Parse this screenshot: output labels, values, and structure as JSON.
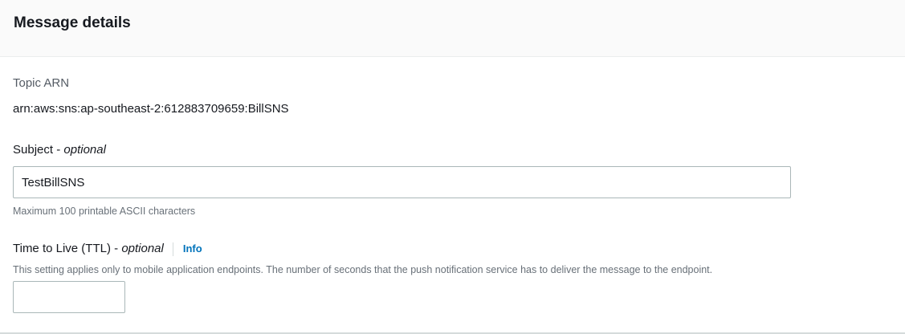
{
  "panel": {
    "title": "Message details"
  },
  "topic_arn": {
    "label": "Topic ARN",
    "value": "arn:aws:sns:ap-southeast-2:612883709659:BillSNS"
  },
  "subject": {
    "label": "Subject",
    "optional_suffix": "optional",
    "separator": " - ",
    "value": "TestBillSNS",
    "hint": "Maximum 100 printable ASCII characters"
  },
  "ttl": {
    "label": "Time to Live (TTL)",
    "separator": " - ",
    "optional_suffix": "optional",
    "info_link": "Info",
    "description": "This setting applies only to mobile application endpoints. The number of seconds that the push notification service has to deliver the message to the endpoint.",
    "value": ""
  },
  "colors": {
    "header_bg": "#fafafa",
    "link": "#0073bb",
    "border": "#aab7b8",
    "muted_text": "#687078"
  }
}
